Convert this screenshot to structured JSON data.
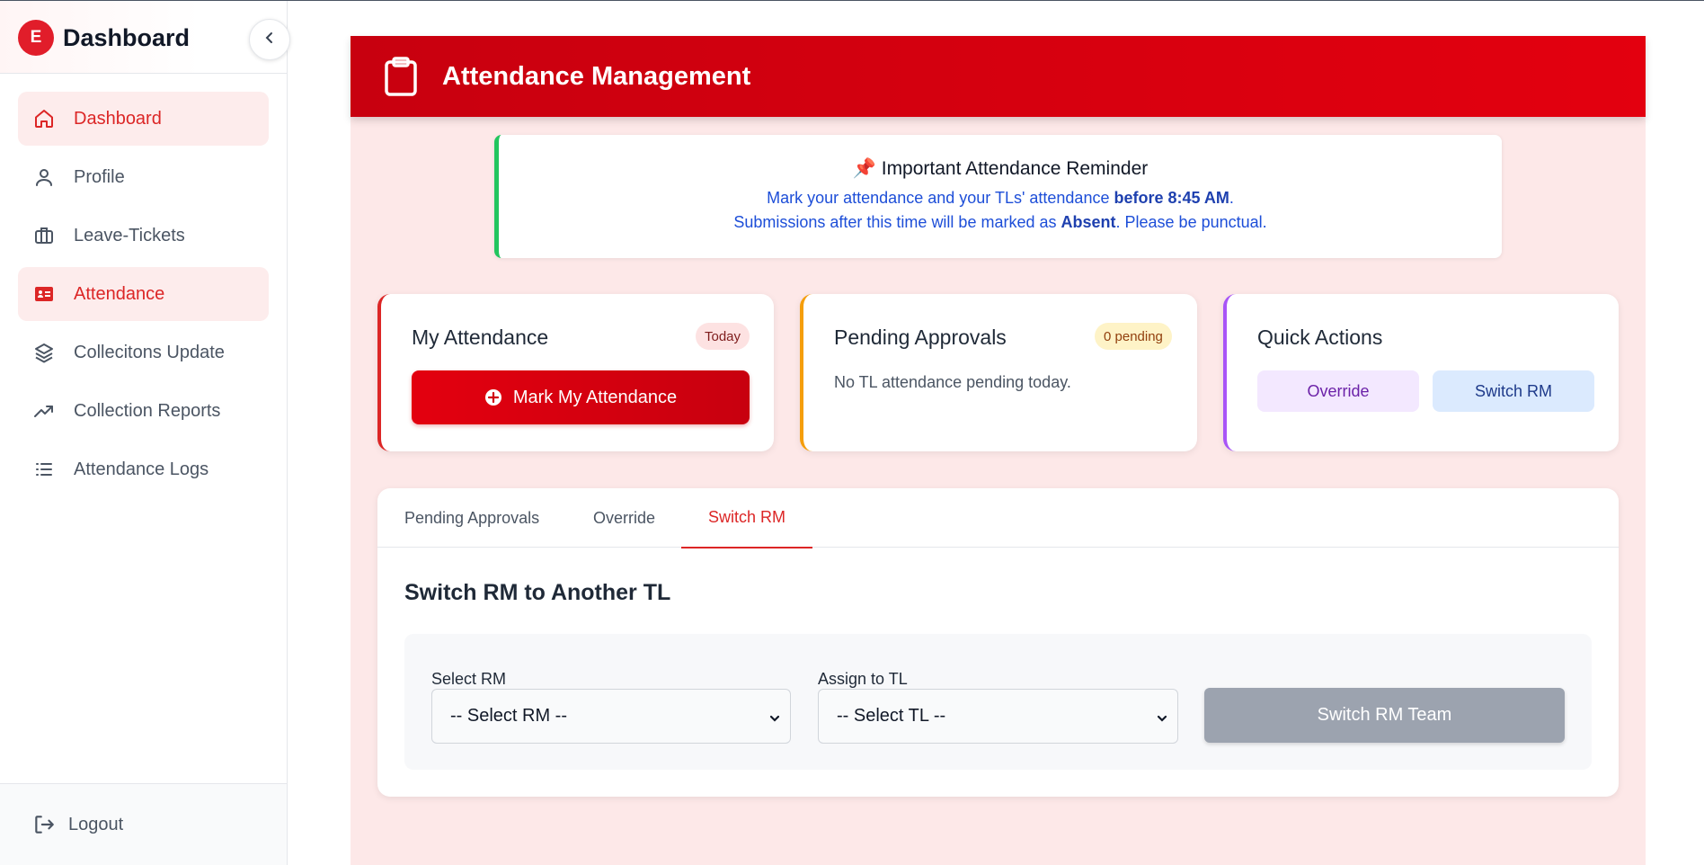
{
  "sidebar": {
    "logo_letter": "E",
    "title": "Dashboard",
    "items": [
      {
        "label": "Dashboard",
        "icon": "home-icon",
        "active": true
      },
      {
        "label": "Profile",
        "icon": "user-icon",
        "active": false
      },
      {
        "label": "Leave-Tickets",
        "icon": "briefcase-icon",
        "active": false
      },
      {
        "label": "Attendance",
        "icon": "id-card-icon",
        "active": true
      },
      {
        "label": "Collecitons Update",
        "icon": "layers-icon",
        "active": false
      },
      {
        "label": "Collection Reports",
        "icon": "trending-up-icon",
        "active": false
      },
      {
        "label": "Attendance Logs",
        "icon": "list-icon",
        "active": false
      }
    ],
    "logout_label": "Logout"
  },
  "header": {
    "title": "Attendance Management",
    "icon": "clipboard-icon"
  },
  "reminder": {
    "icon": "📌",
    "title": "Important Attendance Reminder",
    "line1_pre": "Mark your attendance and your TLs' attendance ",
    "line1_bold": "before 8:45 AM",
    "line1_post": ".",
    "line2_pre": "Submissions after this time will be marked as ",
    "line2_bold": "Absent",
    "line2_post": ". Please be punctual."
  },
  "cards": {
    "my_attendance": {
      "title": "My Attendance",
      "badge": "Today",
      "button": "Mark My Attendance"
    },
    "pending": {
      "title": "Pending Approvals",
      "badge": "0 pending",
      "text": "No TL attendance pending today."
    },
    "quick": {
      "title": "Quick Actions",
      "override": "Override",
      "switch_rm": "Switch RM"
    }
  },
  "tabs": [
    {
      "label": "Pending Approvals",
      "active": false
    },
    {
      "label": "Override",
      "active": false
    },
    {
      "label": "Switch RM",
      "active": true
    }
  ],
  "switch_form": {
    "title": "Switch RM to Another TL",
    "rm_label": "Select RM",
    "rm_value": "-- Select RM --",
    "tl_label": "Assign to TL",
    "tl_value": "-- Select TL --",
    "submit": "Switch RM Team"
  },
  "colors": {
    "accent": "#dc2626",
    "header_red": "#e3000f",
    "reminder_border": "#22c55e",
    "my_attendance_border": "#dc2626",
    "pending_border": "#f59e0b",
    "quick_border": "#a855f7",
    "disabled_button": "#9ca3af"
  }
}
